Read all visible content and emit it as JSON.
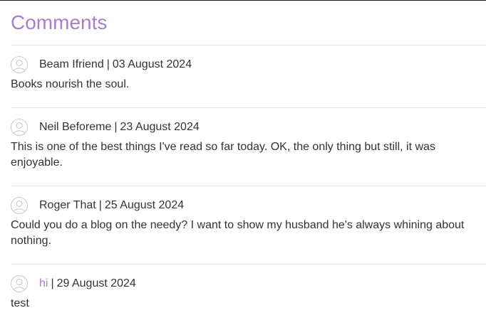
{
  "section": {
    "title": "Comments"
  },
  "comments": [
    {
      "author": "Beam Ifriend",
      "separator": "|",
      "date": "03 August 2024",
      "text": "Books nourish the soul."
    },
    {
      "author": "Neil Beforeme",
      "separator": "|",
      "date": "23 August 2024",
      "text": "This is one of the best things I've read so far today. OK, the only thing but still, it was enjoyable."
    },
    {
      "author": "Roger That",
      "separator": "|",
      "date": "25 August 2024",
      "text": "Could you do a blog on the needy? I want to show my husband he's always whining about nothing."
    },
    {
      "author": "hi",
      "separator": "|",
      "date": "29 August 2024",
      "text": "test"
    }
  ],
  "colors": {
    "accent": "#a97fc9",
    "text": "#333333",
    "divider": "#e6e6e6"
  },
  "icons": {
    "avatar": "user-avatar-icon"
  }
}
